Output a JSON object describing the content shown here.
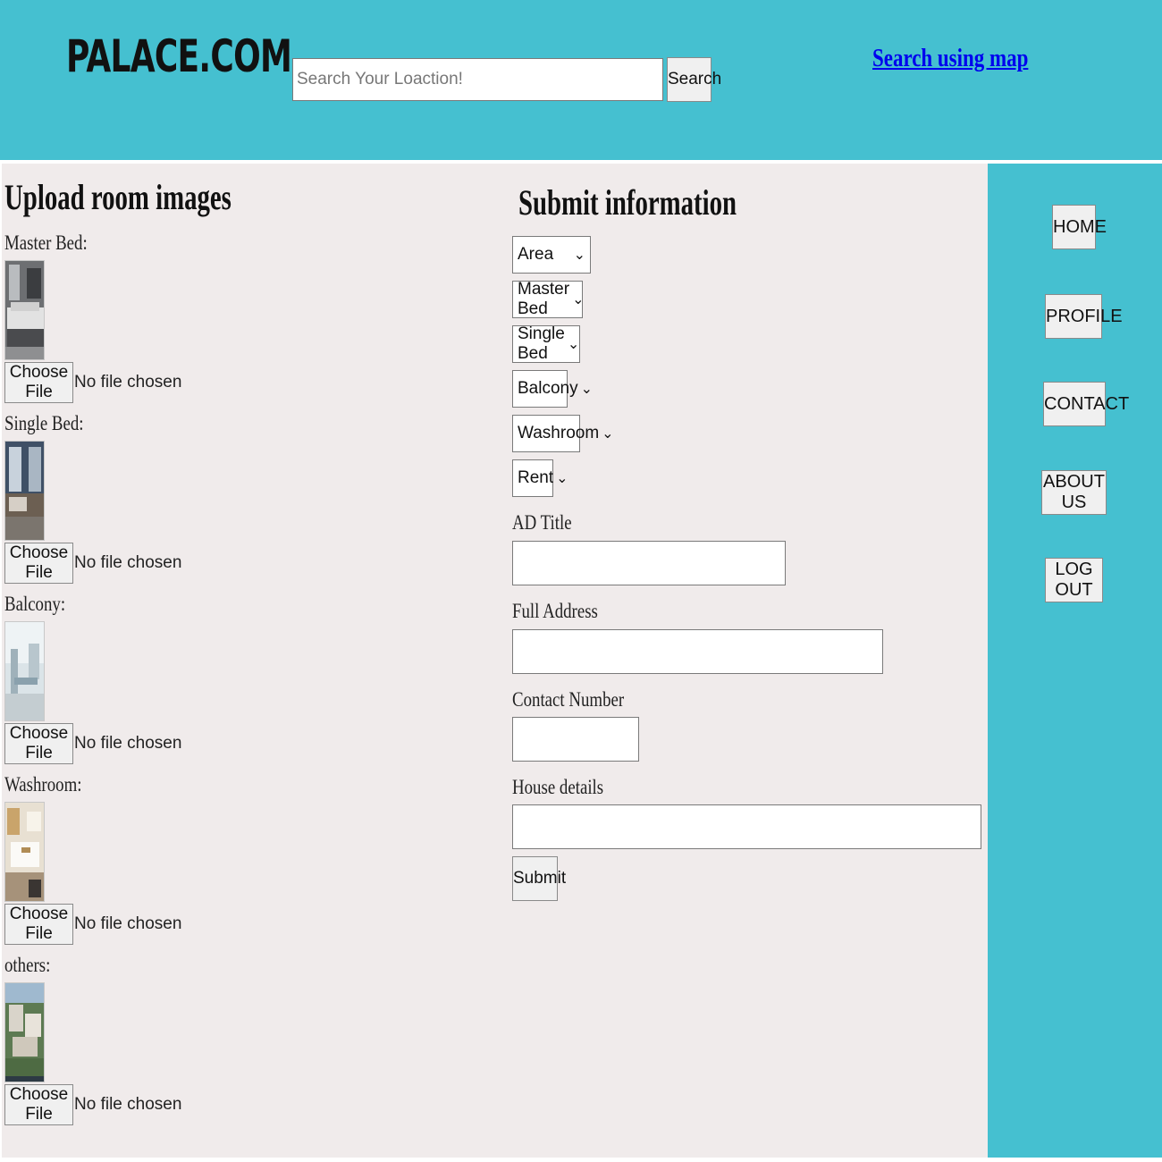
{
  "header": {
    "logo": "PALACE.COM",
    "search_placeholder": "Search Your Loaction!",
    "search_button": "Search",
    "map_link": "Search using map"
  },
  "upload": {
    "title": "Upload room images",
    "sections": [
      {
        "label": "Master Bed:",
        "button": "Choose File",
        "status": "No file chosen"
      },
      {
        "label": "Single Bed:",
        "button": "Choose File",
        "status": "No file chosen"
      },
      {
        "label": "Balcony:",
        "button": "Choose File",
        "status": "No file chosen"
      },
      {
        "label": "Washroom:",
        "button": "Choose File",
        "status": "No file chosen"
      },
      {
        "label": "others:",
        "button": "Choose File",
        "status": "No file chosen"
      }
    ]
  },
  "form": {
    "title": "Submit information",
    "selects": [
      {
        "value": "Area"
      },
      {
        "value": "Master Bed"
      },
      {
        "value": "Single Bed"
      },
      {
        "value": "Balcony"
      },
      {
        "value": "Washroom"
      },
      {
        "value": "Rent"
      }
    ],
    "fields": [
      {
        "label": "AD Title",
        "value": ""
      },
      {
        "label": "Full Address",
        "value": ""
      },
      {
        "label": "Contact Number",
        "value": ""
      },
      {
        "label": "House details",
        "value": ""
      }
    ],
    "submit": "Submit"
  },
  "nav": {
    "items": [
      "HOME",
      "PROFILE",
      "CONTACT",
      "ABOUT US",
      "LOG OUT"
    ]
  },
  "colors": {
    "header_bg": "#45c0d0",
    "content_bg": "#f0ebeb",
    "link": "#0000ee"
  }
}
